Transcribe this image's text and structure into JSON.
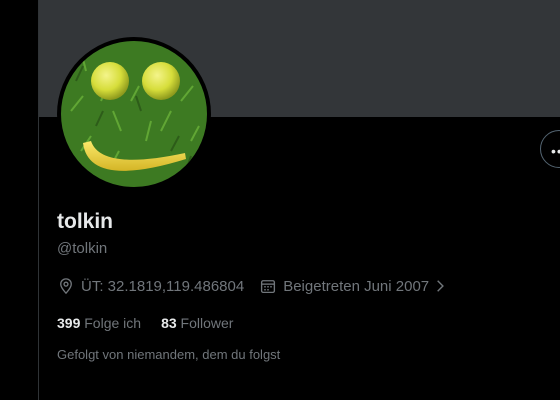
{
  "profile": {
    "display_name": "tolkin",
    "handle": "@tolkin",
    "location": "ÜT: 32.1819,119.486804",
    "joined": "Beigetreten Juni 2007"
  },
  "stats": {
    "following_count": "399",
    "following_label": "Folge ich",
    "followers_count": "83",
    "followers_label": "Follower"
  },
  "followed_by": "Gefolgt von niemandem, dem du folgst",
  "icons": {
    "location": "location-pin-icon",
    "calendar": "calendar-icon",
    "chevron": "chevron-right-icon",
    "more": "more-options-icon"
  },
  "colors": {
    "background": "#000000",
    "banner": "#333639",
    "primary_text": "#e7e9ea",
    "secondary_text": "#71767b"
  }
}
